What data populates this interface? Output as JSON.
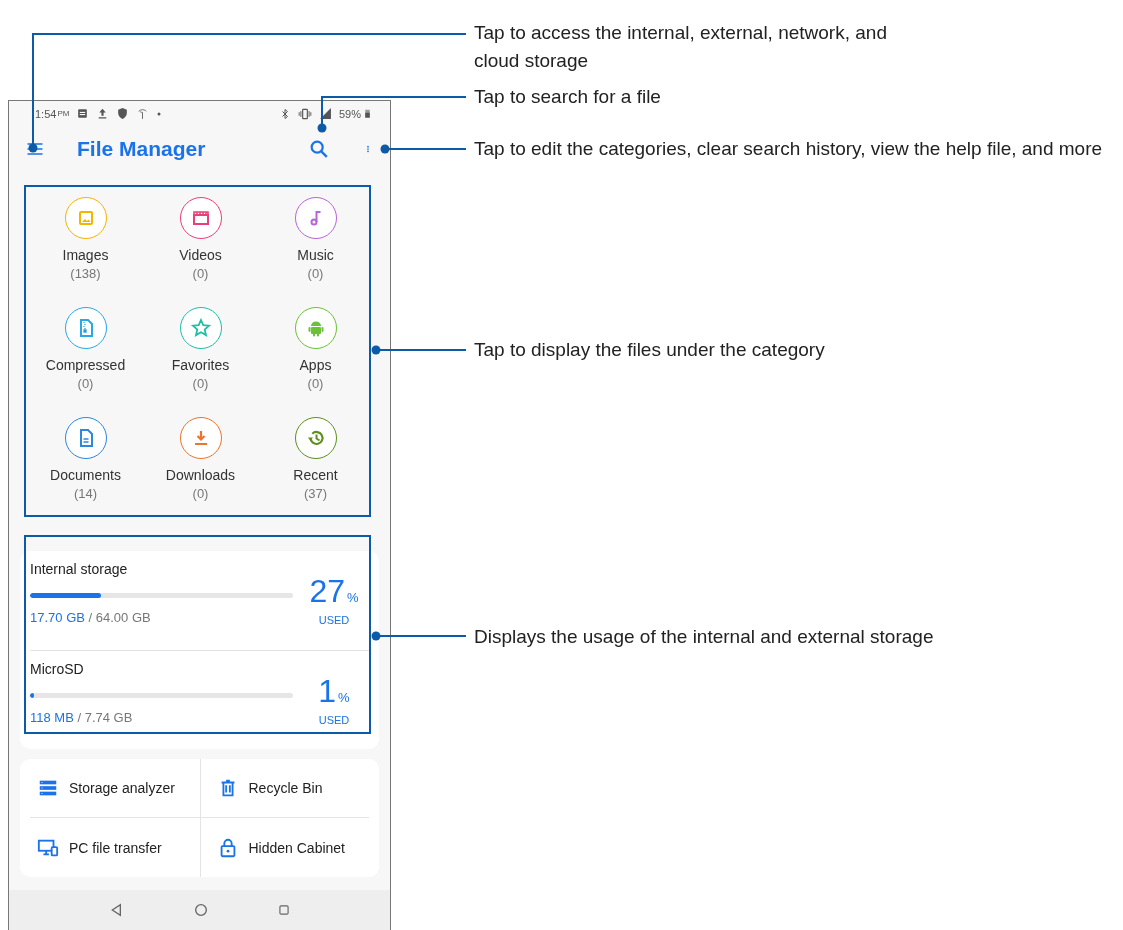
{
  "status_bar": {
    "time": "1:54",
    "ampm": "PM",
    "battery": "59%"
  },
  "app_bar": {
    "title": "File Manager"
  },
  "categories": [
    {
      "label": "Images",
      "count": "(138)",
      "color": "#f5b400",
      "kind": "image"
    },
    {
      "label": "Videos",
      "count": "(0)",
      "color": "#e9407a",
      "kind": "video"
    },
    {
      "label": "Music",
      "count": "(0)",
      "color": "#b765d6",
      "kind": "music"
    },
    {
      "label": "Compressed",
      "count": "(0)",
      "color": "#2aa7e6",
      "kind": "archive"
    },
    {
      "label": "Favorites",
      "count": "(0)",
      "color": "#1fbfa6",
      "kind": "star"
    },
    {
      "label": "Apps",
      "count": "(0)",
      "color": "#6cc236",
      "kind": "android"
    },
    {
      "label": "Documents",
      "count": "(14)",
      "color": "#2d86e0",
      "kind": "document"
    },
    {
      "label": "Downloads",
      "count": "(0)",
      "color": "#e8762e",
      "kind": "download"
    },
    {
      "label": "Recent",
      "count": "(37)",
      "color": "#5f8f1c",
      "kind": "history"
    }
  ],
  "storage": [
    {
      "name": "Internal storage",
      "used": "17.70 GB",
      "total": " / 64.00 GB",
      "percent": "27",
      "unit": "%",
      "used_label": "USED",
      "level": 0.27
    },
    {
      "name": "MicroSD",
      "used": "118 MB",
      "total": " / 7.74 GB",
      "percent": "1",
      "unit": "%",
      "used_label": "USED",
      "level": 0.015
    }
  ],
  "tools": [
    {
      "label": "Storage analyzer",
      "kind": "analyzer"
    },
    {
      "label": "Recycle Bin",
      "kind": "trash"
    },
    {
      "label": "PC file transfer",
      "kind": "pc"
    },
    {
      "label": "Hidden Cabinet",
      "kind": "lock"
    }
  ],
  "callouts": [
    "Tap to access the internal, external, network, and cloud storage",
    "Tap to search for a file",
    "Tap to edit the categories, clear search history, view the help file, and more",
    "Tap to display the files under the category",
    "Displays the usage of the internal and external storage"
  ]
}
